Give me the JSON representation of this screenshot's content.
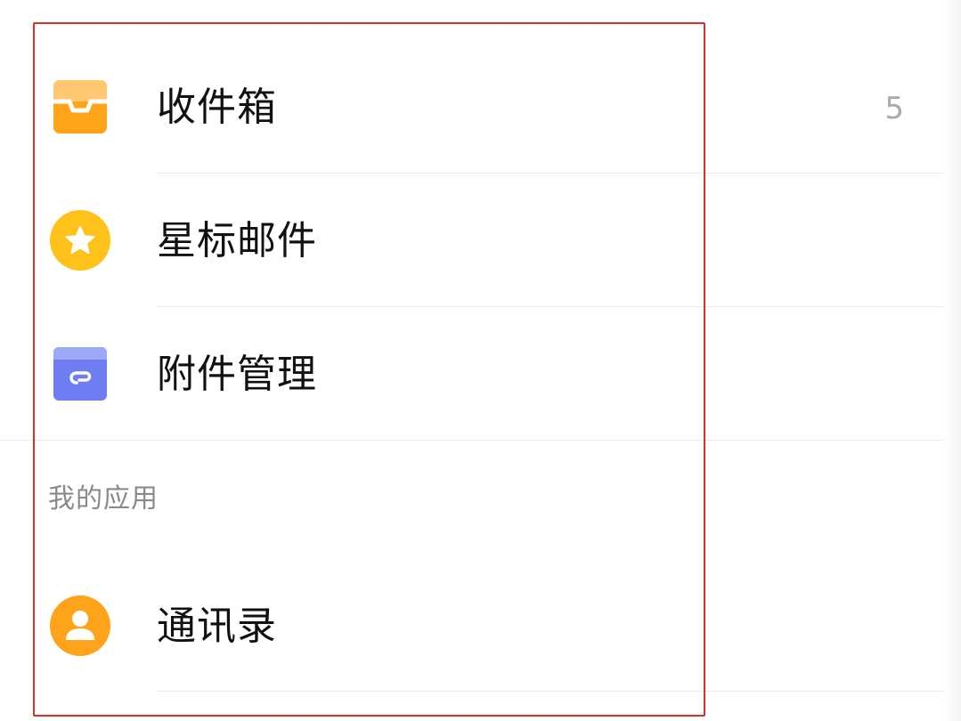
{
  "folders": [
    {
      "id": "inbox",
      "label": "收件箱",
      "icon": "inbox-tray-icon",
      "badge": "5"
    },
    {
      "id": "starred",
      "label": "星标邮件",
      "icon": "star-circle-icon"
    },
    {
      "id": "attachments",
      "label": "附件管理",
      "icon": "attachment-folder-icon"
    }
  ],
  "apps_section": {
    "title": "我的应用",
    "items": [
      {
        "id": "contacts",
        "label": "通讯录",
        "icon": "contact-person-icon"
      }
    ]
  },
  "colors": {
    "inbox_orange": "#FFA41A",
    "star_yellow": "#FFC21A",
    "attachment_blue": "#6E7EF2",
    "contacts_orange": "#FFA31A",
    "highlight_red": "#D9302C",
    "badge_gray": "#AAAAAA",
    "section_gray": "#8A8A8A"
  }
}
